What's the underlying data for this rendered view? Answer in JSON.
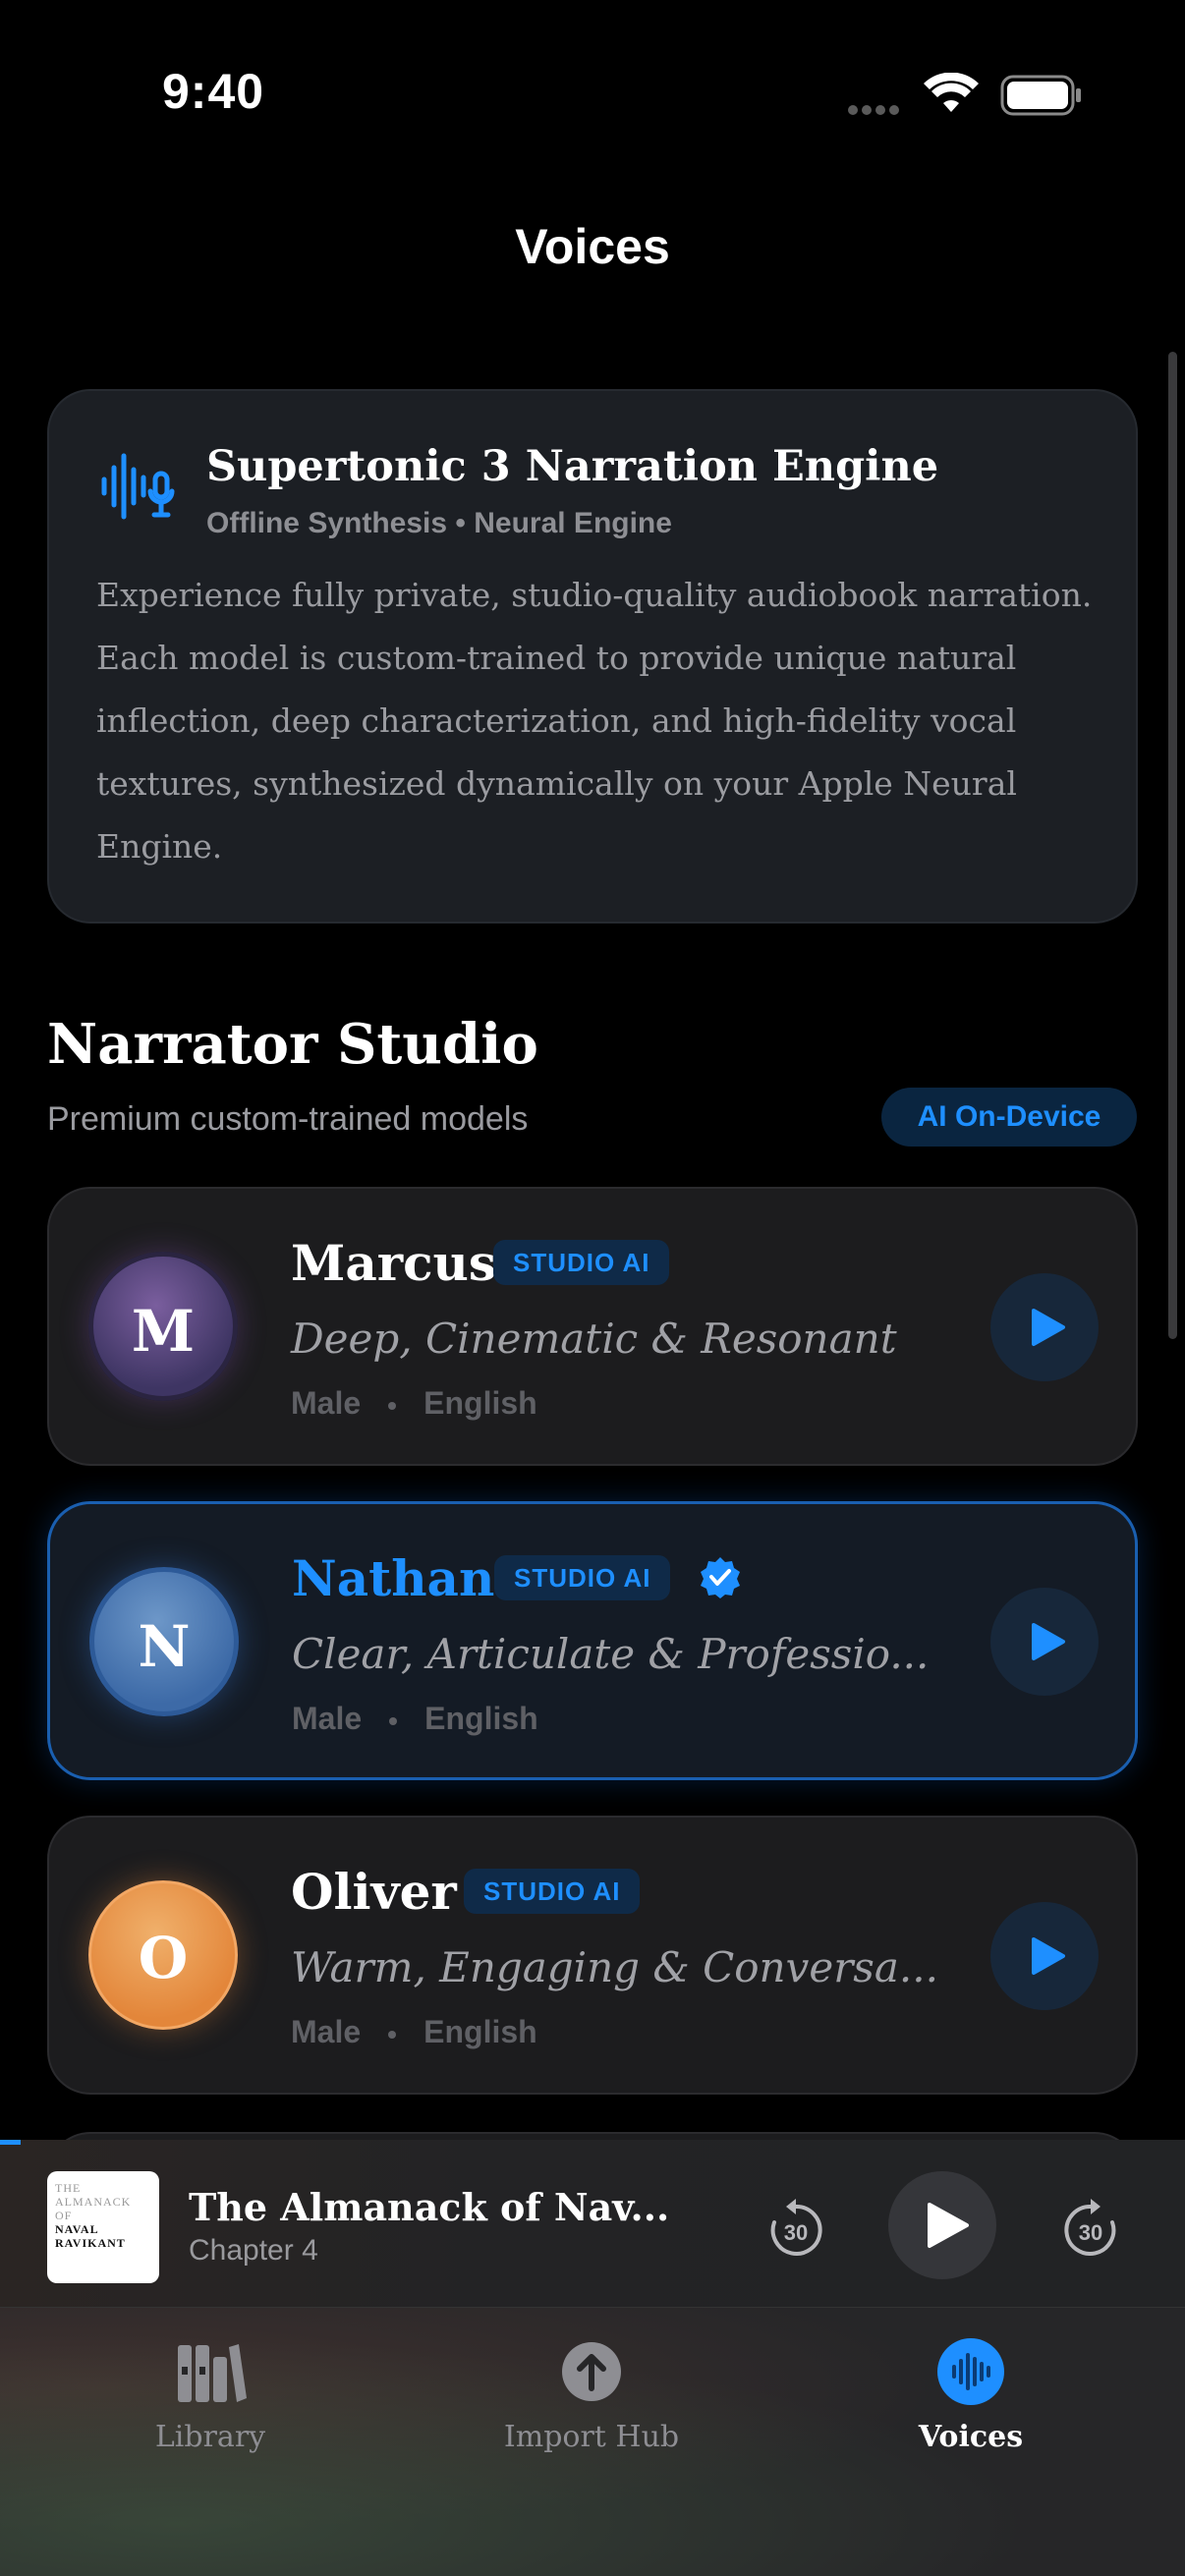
{
  "status_bar": {
    "time": "9:40"
  },
  "nav": {
    "title": "Voices"
  },
  "engine": {
    "title": "Supertonic 3 Narration Engine",
    "subtitle": "Offline Synthesis • Neural Engine",
    "description": "Experience fully private, studio-quality audiobook narration. Each model is custom-trained to provide unique natural inflection, deep characterization, and high-fidelity vocal textures, synthesized dynamically on your Apple Neural Engine.",
    "icon": "waveform-mic-icon"
  },
  "section": {
    "title": "Narrator Studio",
    "subtitle": "Premium custom-trained models",
    "badge": "AI On-Device"
  },
  "narrators": [
    {
      "initial": "M",
      "name": "Marcus",
      "badge": "STUDIO AI",
      "description": "Deep, Cinematic & Resonant",
      "gender": "Male",
      "language": "English",
      "selected": false
    },
    {
      "initial": "N",
      "name": "Nathan",
      "badge": "STUDIO AI",
      "description": "Clear, Articulate & Professio...",
      "gender": "Male",
      "language": "English",
      "selected": true
    },
    {
      "initial": "O",
      "name": "Oliver",
      "badge": "STUDIO AI",
      "description": "Warm, Engaging & Conversa...",
      "gender": "Male",
      "language": "English",
      "selected": false
    }
  ],
  "mini_player": {
    "title": "The Almanack of Nav...",
    "chapter": "Chapter 4",
    "cover_lines": [
      "THE",
      "ALMANACK",
      "OF",
      "NAVAL",
      "RAVIKANT"
    ],
    "skip_back_seconds": "30",
    "skip_forward_seconds": "30",
    "progress": 0.017
  },
  "tabs": [
    {
      "label": "Library",
      "icon": "books-icon",
      "active": false
    },
    {
      "label": "Import Hub",
      "icon": "upload-arrow-icon",
      "active": false
    },
    {
      "label": "Voices",
      "icon": "waveform-icon",
      "active": true
    }
  ],
  "colors": {
    "accent": "#1e8fff",
    "background": "#000000",
    "card": "#1c1c1e"
  }
}
